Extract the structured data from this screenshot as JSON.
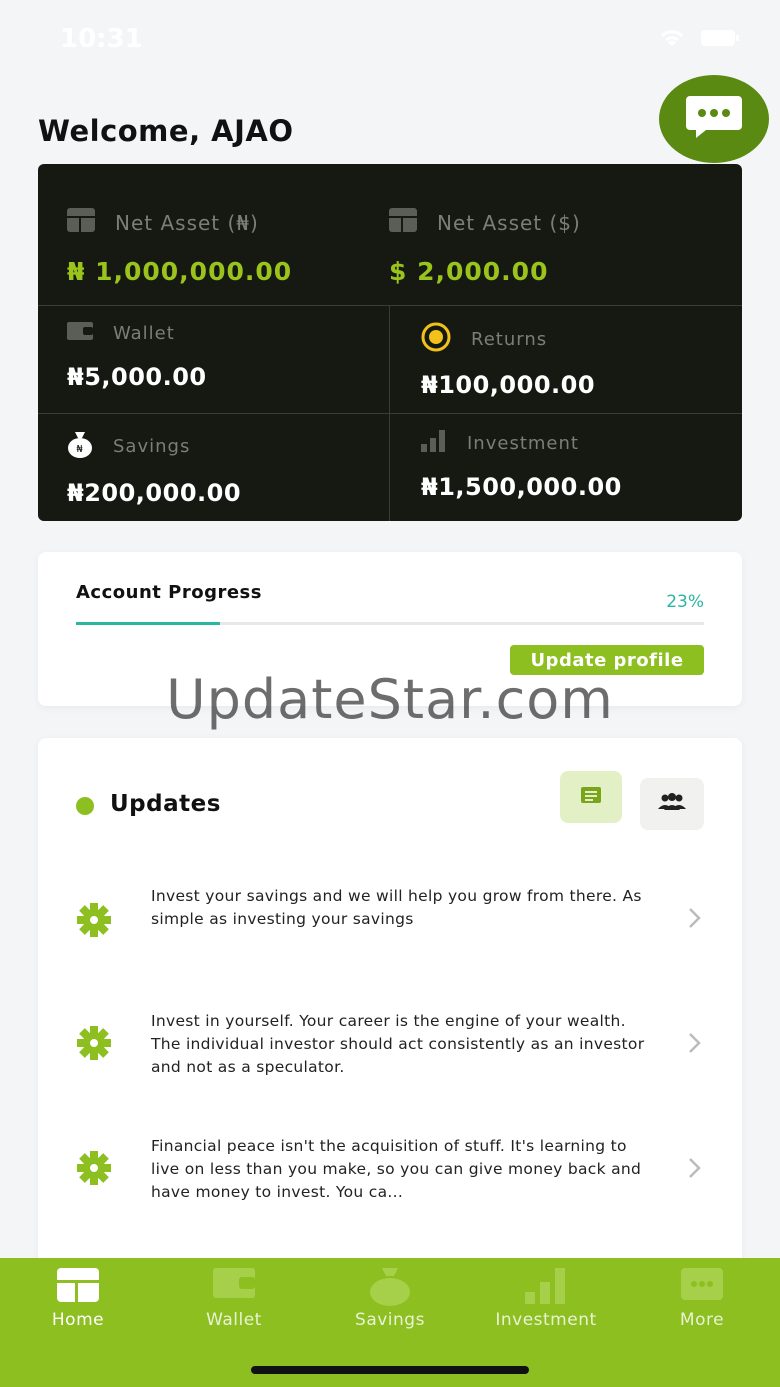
{
  "status_bar": {
    "time": "10:31"
  },
  "header": {
    "welcome": "Welcome, AJAO"
  },
  "assets": {
    "net_naira_label": "Net Asset (₦)",
    "net_naira_value": "₦ 1,000,000.00",
    "net_dollar_label": "Net Asset ($)",
    "net_dollar_value": "$ 2,000.00",
    "wallet_label": "Wallet",
    "wallet_value": "₦5,000.00",
    "returns_label": "Returns",
    "returns_value": "₦100,000.00",
    "savings_label": "Savings",
    "savings_value": "₦200,000.00",
    "investment_label": "Investment",
    "investment_value": "₦1,500,000.00"
  },
  "progress": {
    "title": "Account Progress",
    "percent_label": "23%",
    "percent": 23,
    "button": "Update profile"
  },
  "watermark": "UpdateStar.com",
  "updates": {
    "title": "Updates",
    "items": [
      {
        "text": "Invest your savings and we will help you grow from there. As simple as investing your savings"
      },
      {
        "text": "Invest in yourself. Your career is the engine of your wealth. The individual investor should act consistently as an investor and not as a speculator."
      },
      {
        "text": "Financial peace isn't the acquisition of stuff. It's learning to live on less than you make, so you can give money back and have money to invest. You ca..."
      }
    ]
  },
  "nav": {
    "items": [
      {
        "label": "Home",
        "icon": "home-icon"
      },
      {
        "label": "Wallet",
        "icon": "wallet-icon"
      },
      {
        "label": "Savings",
        "icon": "savings-icon"
      },
      {
        "label": "Investment",
        "icon": "investment-icon"
      },
      {
        "label": "More",
        "icon": "more-icon"
      }
    ]
  },
  "colors": {
    "brand_green": "#8cbf1f",
    "dark_card": "#161912",
    "chat_green": "#5a8a12",
    "progress_teal": "#2bb6a0"
  }
}
